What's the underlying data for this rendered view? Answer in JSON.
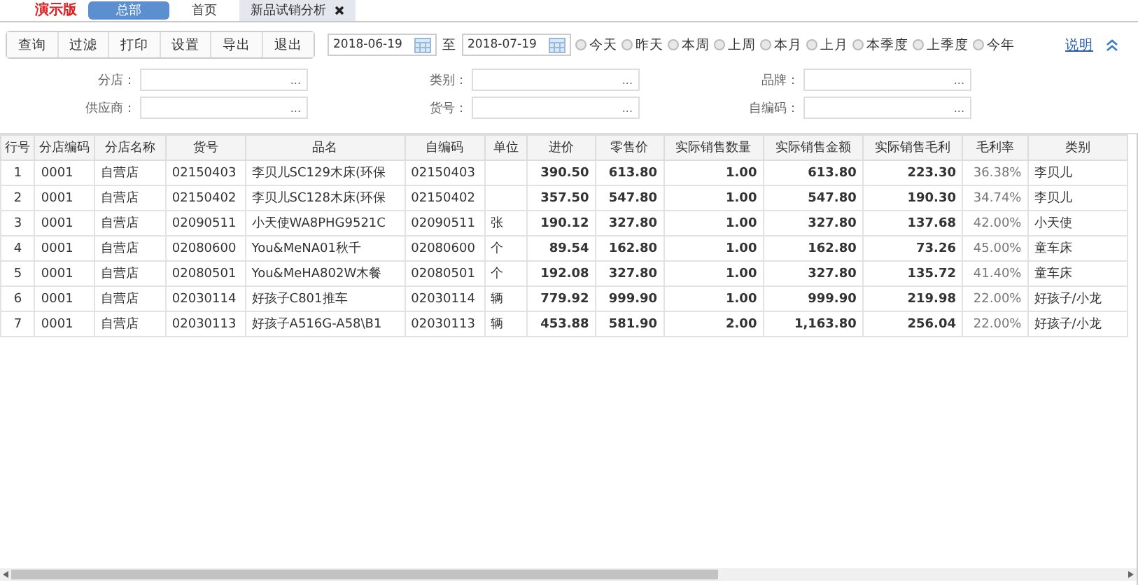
{
  "top_bar": {
    "edition": "演示版",
    "org_button": "总部",
    "tabs": [
      {
        "label": "首页",
        "selected": false,
        "closable": false
      },
      {
        "label": "新品试销分析",
        "selected": true,
        "closable": true
      }
    ]
  },
  "toolbar": {
    "buttons": [
      "查询",
      "过滤",
      "打印",
      "设置",
      "导出",
      "退出"
    ],
    "date_from": "2018-06-19",
    "date_separator": "至",
    "date_to": "2018-07-19",
    "periods": [
      {
        "label": "今天",
        "selected": false
      },
      {
        "label": "昨天",
        "selected": false
      },
      {
        "label": "本周",
        "selected": false
      },
      {
        "label": "上周",
        "selected": false
      },
      {
        "label": "本月",
        "selected": false
      },
      {
        "label": "上月",
        "selected": false
      },
      {
        "label": "本季度",
        "selected": false
      },
      {
        "label": "上季度",
        "selected": false
      },
      {
        "label": "今年",
        "selected": false
      }
    ],
    "help_link": "说明",
    "collapsed": false
  },
  "filters": [
    {
      "label": "分店：",
      "picker": "..."
    },
    {
      "label": "类别：",
      "picker": "..."
    },
    {
      "label": "品牌：",
      "picker": "..."
    },
    {
      "label": "供应商：",
      "picker": "..."
    },
    {
      "label": "货号：",
      "picker": "..."
    },
    {
      "label": "自编码：",
      "picker": "..."
    }
  ],
  "table": {
    "columns": [
      {
        "label": "行号",
        "kind": "index"
      },
      {
        "label": "分店编码",
        "kind": "text"
      },
      {
        "label": "分店名称",
        "kind": "text"
      },
      {
        "label": "货号",
        "kind": "text"
      },
      {
        "label": "品名",
        "kind": "text"
      },
      {
        "label": "自编码",
        "kind": "text"
      },
      {
        "label": "单位",
        "kind": "text"
      },
      {
        "label": "进价",
        "kind": "number"
      },
      {
        "label": "零售价",
        "kind": "number"
      },
      {
        "label": "实际销售数量",
        "kind": "number"
      },
      {
        "label": "实际销售金额",
        "kind": "number"
      },
      {
        "label": "实际销售毛利",
        "kind": "number"
      },
      {
        "label": "毛利率",
        "kind": "percent"
      },
      {
        "label": "类别",
        "kind": "text"
      }
    ],
    "rows": [
      [
        "1",
        "0001",
        "自营店",
        "02150403",
        "李贝儿SC129木床(环保",
        "02150403",
        "",
        "390.50",
        "613.80",
        "1.00",
        "613.80",
        "223.30",
        "36.38%",
        "李贝儿"
      ],
      [
        "2",
        "0001",
        "自营店",
        "02150402",
        "李贝儿SC128木床(环保",
        "02150402",
        "",
        "357.50",
        "547.80",
        "1.00",
        "547.80",
        "190.30",
        "34.74%",
        "李贝儿"
      ],
      [
        "3",
        "0001",
        "自营店",
        "02090511",
        "小天使WA8PHG9521C",
        "02090511",
        "张",
        "190.12",
        "327.80",
        "1.00",
        "327.80",
        "137.68",
        "42.00%",
        "小天使"
      ],
      [
        "4",
        "0001",
        "自营店",
        "02080600",
        "You&MeNA01秋千",
        "02080600",
        "个",
        "89.54",
        "162.80",
        "1.00",
        "162.80",
        "73.26",
        "45.00%",
        "童车床"
      ],
      [
        "5",
        "0001",
        "自营店",
        "02080501",
        "You&MeHA802W木餐",
        "02080501",
        "个",
        "192.08",
        "327.80",
        "1.00",
        "327.80",
        "135.72",
        "41.40%",
        "童车床"
      ],
      [
        "6",
        "0001",
        "自营店",
        "02030114",
        "好孩子C801推车",
        "02030114",
        "辆",
        "779.92",
        "999.90",
        "1.00",
        "999.90",
        "219.98",
        "22.00%",
        "好孩子/小龙"
      ],
      [
        "7",
        "0001",
        "自营店",
        "02030113",
        "好孩子A516G-A58\\B1",
        "02030113",
        "辆",
        "453.88",
        "581.90",
        "2.00",
        "1,163.80",
        "256.04",
        "22.00%",
        "好孩子/小龙"
      ]
    ]
  }
}
